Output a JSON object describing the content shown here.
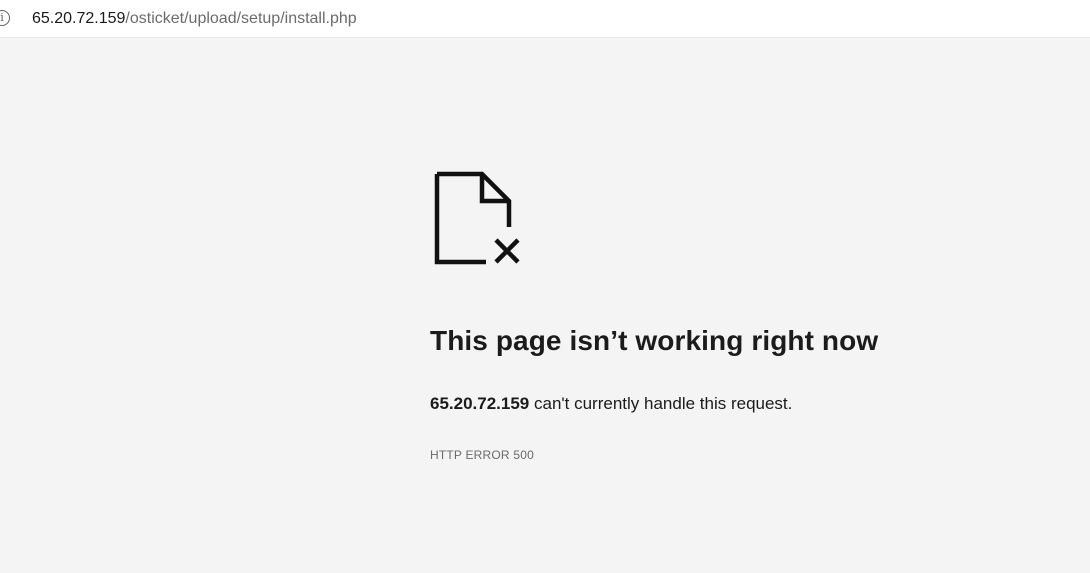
{
  "address_bar": {
    "url_host": "65.20.72.159",
    "url_path": "/osticket/upload/setup/install.php",
    "info_icon": "info-circle-icon"
  },
  "error_page": {
    "icon": "broken-document-icon",
    "title": "This page isn’t working right now",
    "message_host": "65.20.72.159",
    "message_text": " can't currently handle this request.",
    "error_code": "HTTP ERROR 500"
  }
}
